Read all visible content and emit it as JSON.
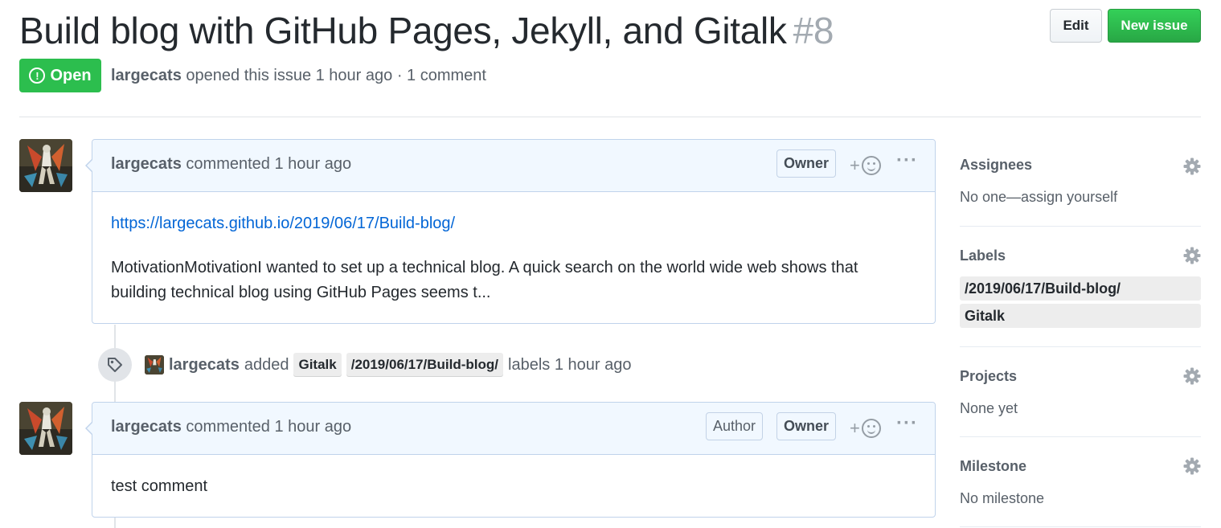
{
  "issue": {
    "title": "Build blog with GitHub Pages, Jekyll, and Gitalk",
    "number": "#8",
    "state": "Open",
    "author": "largecats",
    "meta_text": "opened this issue 1 hour ago · 1 comment"
  },
  "header_buttons": {
    "edit": "Edit",
    "new_issue": "New issue"
  },
  "comments": [
    {
      "author": "largecats",
      "time_text": "commented 1 hour ago",
      "badges": [
        "Owner"
      ],
      "link": "https://largecats.github.io/2019/06/17/Build-blog/",
      "body": "MotivationMotivationI wanted to set up a technical blog. A quick search on the world wide web shows that building technical blog using GitHub Pages seems t..."
    },
    {
      "author": "largecats",
      "time_text": "commented 1 hour ago",
      "badges": [
        "Author",
        "Owner"
      ],
      "body": "test comment"
    }
  ],
  "event": {
    "author": "largecats",
    "action": "added",
    "labels": [
      "Gitalk",
      "/2019/06/17/Build-blog/"
    ],
    "suffix": "labels 1 hour ago"
  },
  "reaction": {
    "plus": "+"
  },
  "more": "···",
  "sidebar": {
    "assignees": {
      "heading": "Assignees",
      "value": "No one—assign yourself"
    },
    "labels": {
      "heading": "Labels",
      "items": [
        "/2019/06/17/Build-blog/",
        "Gitalk"
      ]
    },
    "projects": {
      "heading": "Projects",
      "value": "None yet"
    },
    "milestone": {
      "heading": "Milestone",
      "value": "No milestone"
    }
  },
  "colors": {
    "open_green": "#2cbe4e",
    "new_issue_green": "#28a745",
    "link_blue": "#0366d6",
    "comment_header_bg": "#f1f8ff",
    "label_gray": "#ededed"
  }
}
